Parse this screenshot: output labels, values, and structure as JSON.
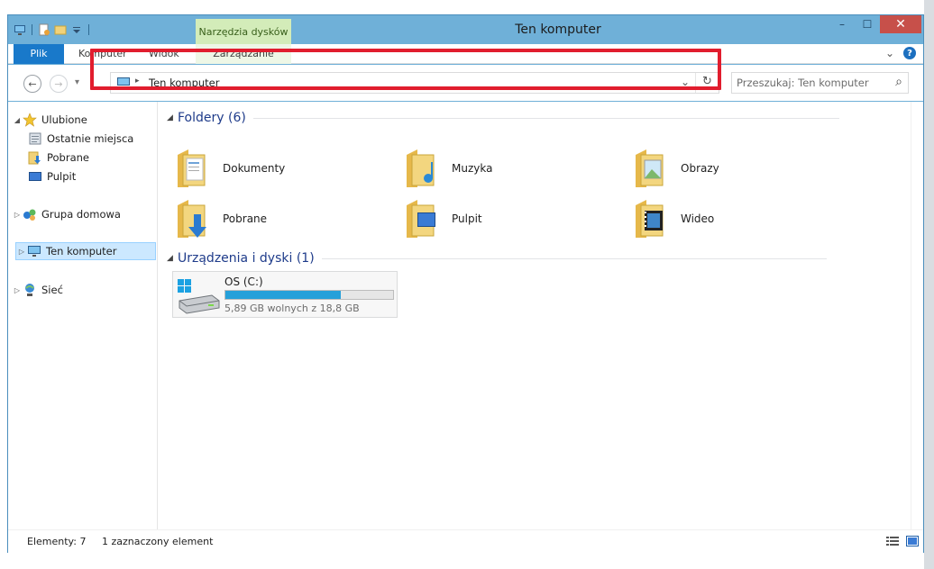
{
  "window": {
    "title": "Ten komputer",
    "context_tab_header": "Narzędzia dysków",
    "buttons": {
      "minimize": "–",
      "maximize": "☐",
      "close": "✕"
    }
  },
  "ribbon": {
    "tabs": [
      "Plik",
      "Komputer",
      "Widok",
      "Zarządzanie"
    ],
    "expand_glyph": "⌄",
    "help_glyph": "?"
  },
  "nav": {
    "back_glyph": "←",
    "forward_glyph": "→",
    "recent_glyph": "▾",
    "address_separator": "▸",
    "address_path": "Ten komputer",
    "address_dropdown_glyph": "⌄",
    "refresh_glyph": "↻",
    "search_placeholder": "Przeszukaj: Ten komputer",
    "search_glyph": "⌕"
  },
  "tree": {
    "favorites": "Ulubione",
    "recent_places": "Ostatnie miejsca",
    "downloads": "Pobrane",
    "desktop": "Pulpit",
    "homegroup": "Grupa domowa",
    "this_pc": "Ten komputer",
    "network": "Sieć",
    "expanded_glyph": "◢",
    "collapsed_glyph": "▷"
  },
  "main": {
    "folders_group": "Foldery (6)",
    "devices_group": "Urządzenia i dyski (1)",
    "folders": [
      "Dokumenty",
      "Muzyka",
      "Obrazy",
      "Pobrane",
      "Pulpit",
      "Wideo"
    ],
    "drive": {
      "name": "OS (C:)",
      "free_text": "5,89 GB wolnych z 18,8 GB",
      "used_fraction": 0.687
    }
  },
  "status": {
    "items_count": "Elementy: 7",
    "selected": "1 zaznaczony element"
  },
  "colors": {
    "titlebar": "#6fb0d8",
    "file_tab": "#1979ca",
    "context_tab": "#d3ecb9",
    "close_button": "#c7504a",
    "highlight_box": "#e11d2e",
    "drive_fill": "#26a0da",
    "group_title": "#1e3b8a"
  }
}
